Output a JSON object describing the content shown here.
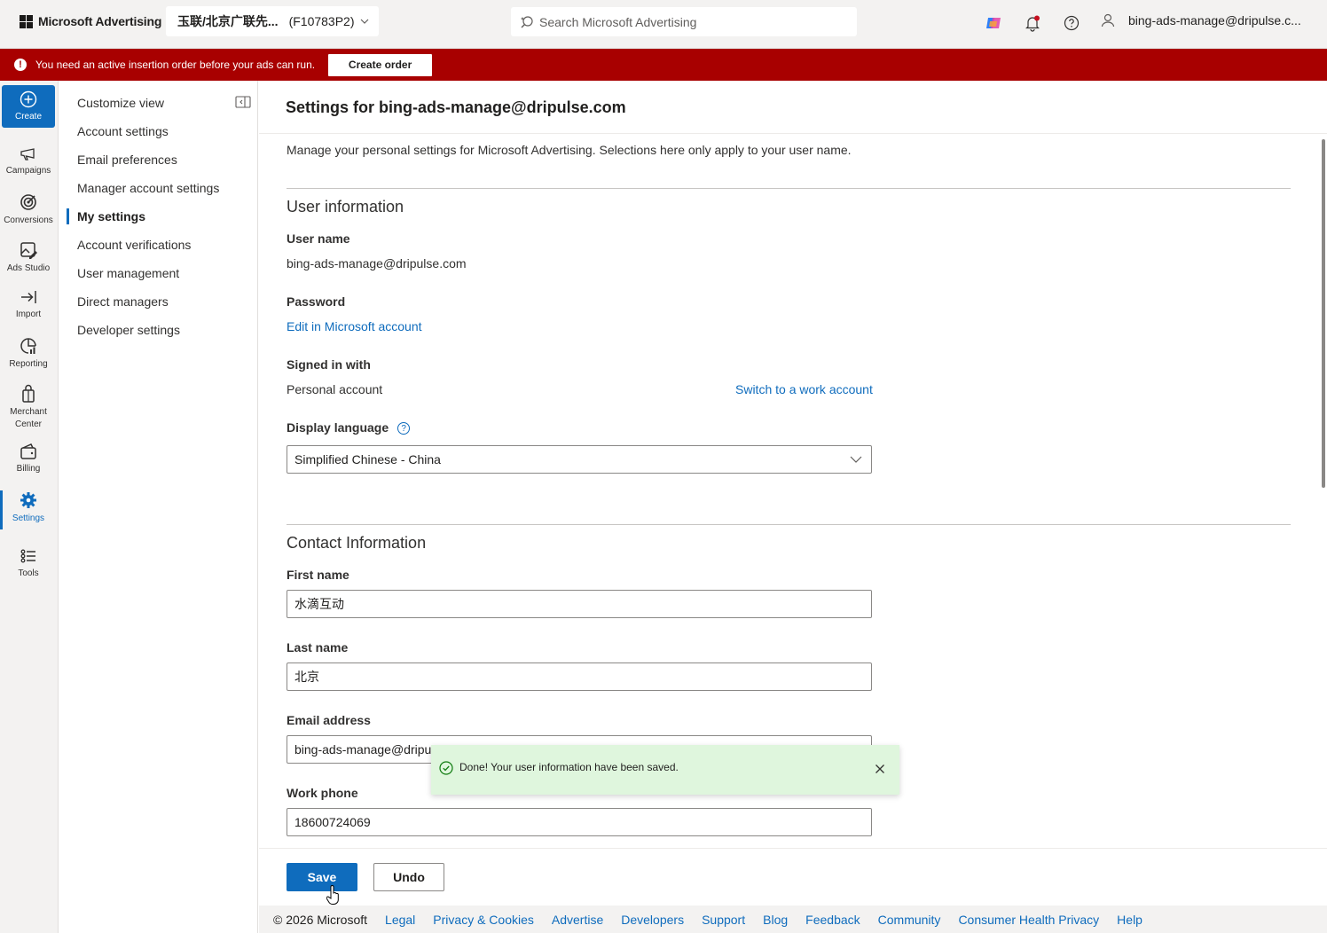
{
  "header": {
    "brand": "Microsoft Advertising",
    "account_name": "玉联/北京广联先...",
    "account_id": "(F10783P2)",
    "search_placeholder": "Search Microsoft Advertising",
    "user_email": "bing-ads-manage@dripulse.c..."
  },
  "alert": {
    "message": "You need an active insertion order before your ads can run.",
    "button": "Create order",
    "color": "#a80000"
  },
  "rail": {
    "create": "Create",
    "campaigns": "Campaigns",
    "conversions": "Conversions",
    "ads_studio": "Ads Studio",
    "import": "Import",
    "reporting": "Reporting",
    "merchant_center_1": "Merchant",
    "merchant_center_2": "Center",
    "billing": "Billing",
    "settings": "Settings",
    "tools": "Tools"
  },
  "subnav": {
    "items": [
      "Customize view",
      "Account settings",
      "Email preferences",
      "Manager account settings",
      "My settings",
      "Account verifications",
      "User management",
      "Direct managers",
      "Developer settings"
    ],
    "selected": "My settings"
  },
  "main": {
    "title": "Settings for bing-ads-manage@dripulse.com",
    "description": "Manage your personal settings for Microsoft Advertising. Selections here only apply to your user name.",
    "user_info": {
      "heading": "User information",
      "username_label": "User name",
      "username_value": "bing-ads-manage@dripulse.com",
      "password_label": "Password",
      "password_link": "Edit in Microsoft account",
      "signed_in_label": "Signed in with",
      "signed_in_value": "Personal account",
      "switch_link": "Switch to a work account",
      "language_label": "Display language",
      "language_help": "?",
      "language_value": "Simplified Chinese - China"
    },
    "contact": {
      "heading": "Contact Information",
      "first_name_label": "First name",
      "first_name_value": "水滴互动",
      "last_name_label": "Last name",
      "last_name_value": "北京",
      "email_label": "Email address",
      "email_value": "bing-ads-manage@dripu",
      "phone_label": "Work phone",
      "phone_value": "18600724069"
    }
  },
  "toast": {
    "message": "Done! Your user information have been saved.",
    "color": "#dff6dd"
  },
  "actions": {
    "save": "Save",
    "undo": "Undo"
  },
  "footer": {
    "copyright": "© 2026 Microsoft",
    "links": [
      "Legal",
      "Privacy & Cookies",
      "Advertise",
      "Developers",
      "Support",
      "Blog",
      "Feedback",
      "Community",
      "Consumer Health Privacy",
      "Help"
    ]
  },
  "colors": {
    "accent": "#0f6cbd"
  }
}
